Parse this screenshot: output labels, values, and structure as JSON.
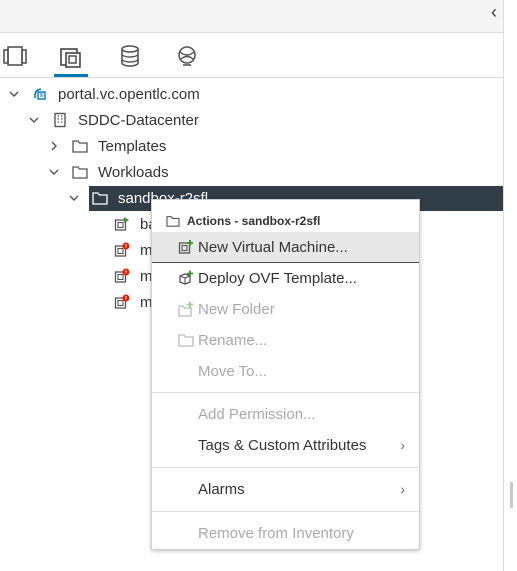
{
  "toolbar": {
    "collapse_glyph": "‹"
  },
  "tabs": [
    {
      "name": "hosts-clusters-icon",
      "active": false
    },
    {
      "name": "vms-templates-icon",
      "active": true
    },
    {
      "name": "storage-icon",
      "active": false
    },
    {
      "name": "networking-icon",
      "active": false
    }
  ],
  "tree": {
    "vcenter": "portal.vc.opentlc.com",
    "datacenter": "SDDC-Datacenter",
    "templates": "Templates",
    "workloads": "Workloads",
    "sandbox": "sandbox-r2sfl",
    "vms": [
      "ba",
      "m",
      "m",
      "m"
    ]
  },
  "menu": {
    "header": "Actions - sandbox-r2sfl",
    "items": {
      "new_vm": "New Virtual Machine...",
      "deploy_ovf": "Deploy OVF Template...",
      "new_folder": "New Folder",
      "rename": "Rename...",
      "move_to": "Move To...",
      "add_permission": "Add Permission...",
      "tags": "Tags & Custom Attributes",
      "alarms": "Alarms",
      "remove_inventory": "Remove from Inventory"
    },
    "submenu_arrow": "›"
  },
  "colors": {
    "accent": "#0079b8",
    "selected_bg": "#313d47",
    "add_green": "#3c8d2e",
    "error_red": "#e12200"
  }
}
